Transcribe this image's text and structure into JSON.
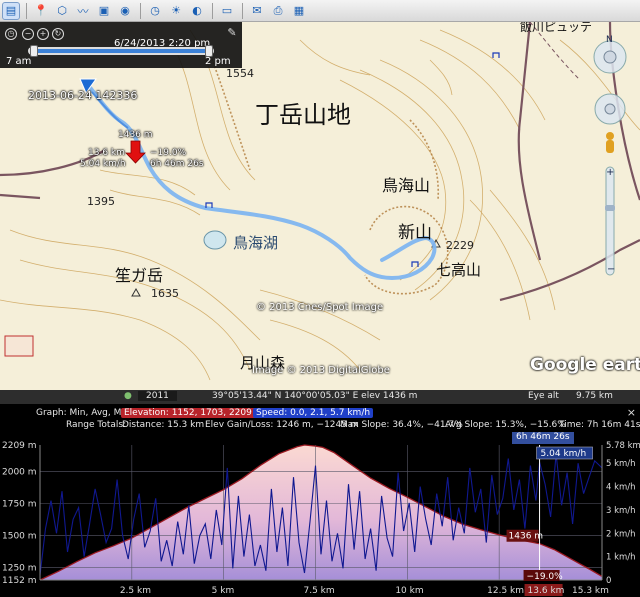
{
  "toolbar": {
    "buttons": [
      "sidebar-icon",
      "placemark-icon",
      "polygon-icon",
      "path-icon",
      "image-overlay-icon",
      "tour-icon",
      "historical-imagery-icon",
      "sun-icon",
      "planets-icon",
      "ruler-icon",
      "email-icon",
      "print-icon",
      "maps-icon"
    ]
  },
  "map": {
    "labels": {
      "region": "丁岳山地",
      "mt_chokai": "鳥海山",
      "shinzan": "新山",
      "shichikozan": "七高山",
      "lake": "鳥海湖",
      "kasagatake": "笙ガ岳",
      "gassan": "月山森",
      "top_text": "飯川ピュッテ"
    },
    "elevations": {
      "peak_1554": "1554",
      "peak_1395": "1395",
      "peak_2229": "2229",
      "peak_1635": "1635"
    },
    "copyright": {
      "cnes": "© 2013 Cnes/Spot Image",
      "digitalglobe": "Image © 2013 DigitalGlobe",
      "logo": "Google earth"
    },
    "time_slider": {
      "date": "6/24/2013   2:20 pm",
      "start": "7 am",
      "end": "2 pm"
    },
    "track_stamp": "2013-06-24 142336",
    "pin": {
      "elevation": "1436 m",
      "distance": "13.6 km",
      "speed": "5.04 km/h",
      "slope": "−19.0%",
      "time": "6h 46m 26s"
    }
  },
  "status_bar": {
    "year": "2011",
    "coords": "39°05'13.44\" N  140°00'05.03\" E  elev  1436 m",
    "eye_alt": "Eye alt",
    "eye_alt_value": "9.75 km"
  },
  "profile": {
    "graph_label": "Graph: Min, Avg, Max",
    "elevation": "Elevation: 1152, 1703, 2209 m",
    "speed": "Speed: 0.0, 2.1, 5.7 km/h",
    "range_label": "Range Totals:",
    "distance": "Distance: 15.3 km",
    "gain_loss": "Elev Gain/Loss: 1246 m, −1245 m",
    "max_slope": "Max Slope: 36.4%, −41.7%",
    "avg_slope": "Avg Slope: 15.3%, −15.6%",
    "time_total": "Time: 7h 16m 41s",
    "cursor_time": "6h 46m 26s",
    "close": "×"
  },
  "chart_data": {
    "type": "line",
    "title": "",
    "xlabel": "",
    "ylabel": "",
    "x_unit": "km",
    "x_ticks": [
      "2.5 km",
      "5 km",
      "7.5 km",
      "10 km",
      "12.5 km",
      "13.6 km",
      "15.3 km"
    ],
    "xlim": [
      0,
      15.3
    ],
    "y_left_ticks": [
      "2209 m",
      "2000 m",
      "1750 m",
      "1500 m",
      "1250 m",
      "1152 m"
    ],
    "y_left_lim": [
      1152,
      2209
    ],
    "y_right_ticks": [
      "5.78 km/h",
      "5 km/h",
      "4 km/h",
      "3 km/h",
      "2 km/h",
      "1 km/h",
      "0"
    ],
    "y_right_lim": [
      0,
      5.78
    ],
    "cursor": {
      "x": 13.6,
      "elevation_label": "1436 m",
      "speed_label": "5.04 km/h",
      "slope_label": "−19.0%",
      "x_label": "13.6 km"
    },
    "series": [
      {
        "name": "Elevation",
        "axis": "left",
        "color": "#9b1a22",
        "x": [
          0,
          0.5,
          1.0,
          1.5,
          2.0,
          2.5,
          3.0,
          3.5,
          4.0,
          4.5,
          5.0,
          5.5,
          6.0,
          6.5,
          7.0,
          7.2,
          7.5,
          7.7,
          8.0,
          8.5,
          9.0,
          9.5,
          10.0,
          10.5,
          11.0,
          11.5,
          12.0,
          12.5,
          13.0,
          13.6,
          14.0,
          14.5,
          15.0,
          15.3
        ],
        "values": [
          1152,
          1220,
          1295,
          1365,
          1420,
          1480,
          1560,
          1640,
          1720,
          1790,
          1860,
          1945,
          2050,
          2140,
          2195,
          2209,
          2200,
          2190,
          2150,
          2050,
          1950,
          1870,
          1800,
          1725,
          1650,
          1590,
          1545,
          1505,
          1470,
          1436,
          1390,
          1310,
          1230,
          1180
        ]
      },
      {
        "name": "Speed",
        "axis": "right",
        "color": "#101890",
        "x": [
          0,
          0.15,
          0.3,
          0.45,
          0.6,
          0.75,
          0.9,
          1.05,
          1.2,
          1.35,
          1.5,
          1.65,
          1.8,
          1.95,
          2.1,
          2.25,
          2.4,
          2.55,
          2.7,
          2.85,
          3.0,
          3.15,
          3.3,
          3.45,
          3.6,
          3.75,
          3.9,
          4.05,
          4.2,
          4.35,
          4.5,
          4.65,
          4.8,
          4.95,
          5.1,
          5.25,
          5.4,
          5.55,
          5.7,
          5.85,
          6.0,
          6.15,
          6.3,
          6.45,
          6.6,
          6.75,
          6.9,
          7.05,
          7.2,
          7.35,
          7.5,
          7.65,
          7.8,
          7.95,
          8.1,
          8.25,
          8.4,
          8.55,
          8.7,
          8.85,
          9.0,
          9.15,
          9.3,
          9.45,
          9.6,
          9.75,
          9.9,
          10.05,
          10.2,
          10.35,
          10.5,
          10.65,
          10.8,
          10.95,
          11.1,
          11.25,
          11.4,
          11.55,
          11.7,
          11.85,
          12.0,
          12.15,
          12.3,
          12.45,
          12.6,
          12.75,
          12.9,
          13.05,
          13.2,
          13.35,
          13.5,
          13.6,
          13.75,
          13.9,
          14.05,
          14.2,
          14.35,
          14.5,
          14.65,
          14.8,
          14.95,
          15.1,
          15.3
        ],
        "values": [
          0.2,
          2.2,
          3.4,
          2.0,
          3.8,
          1.2,
          2.6,
          3.1,
          1.0,
          2.4,
          3.9,
          2.8,
          1.6,
          2.2,
          4.3,
          1.9,
          0.9,
          2.6,
          3.7,
          1.4,
          2.1,
          3.5,
          0.8,
          1.7,
          0.6,
          2.5,
          1.1,
          3.2,
          0.7,
          1.9,
          2.4,
          0.9,
          3.0,
          1.5,
          4.8,
          0.5,
          3.6,
          1.0,
          2.8,
          0.6,
          1.5,
          0.4,
          3.9,
          1.2,
          3.1,
          0.6,
          4.4,
          1.6,
          0.3,
          2.5,
          4.9,
          1.1,
          3.4,
          0.8,
          2.0,
          0.5,
          4.1,
          1.3,
          3.8,
          0.9,
          2.2,
          0.4,
          3.6,
          1.8,
          1.0,
          4.6,
          2.1,
          3.3,
          1.2,
          4.0,
          2.6,
          1.5,
          3.7,
          2.3,
          4.4,
          1.7,
          3.1,
          2.0,
          4.8,
          2.9,
          3.9,
          1.6,
          4.5,
          2.8,
          3.5,
          5.2,
          3.0,
          4.3,
          2.2,
          4.9,
          3.4,
          5.04,
          4.1,
          2.7,
          5.4,
          3.2,
          4.6,
          2.4,
          5.0,
          3.7,
          4.4,
          5.1,
          4.8
        ]
      }
    ]
  }
}
